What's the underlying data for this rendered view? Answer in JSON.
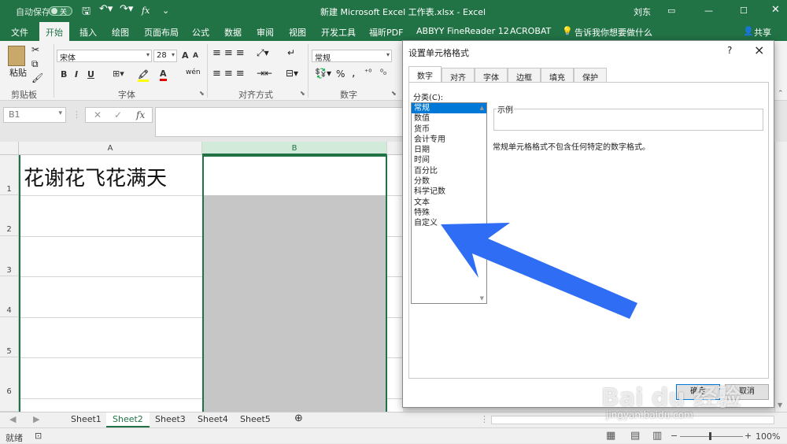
{
  "titlebar": {
    "autosave_label": "自动保存",
    "autosave_state": "关",
    "title": "新建 Microsoft Excel 工作表.xlsx - Excel",
    "user": "刘东"
  },
  "ribbon_tabs": [
    "文件",
    "开始",
    "插入",
    "绘图",
    "页面布局",
    "公式",
    "数据",
    "审阅",
    "视图",
    "开发工具",
    "福昕PDF",
    "ABBYY FineReader 12",
    "ACROBAT"
  ],
  "tell_me": "告诉我你想要做什么",
  "share": "共享",
  "ribbon": {
    "paste": "粘贴",
    "clipboard": "剪贴板",
    "font_name": "宋体",
    "font_size": "28",
    "font_group": "字体",
    "align_group": "对齐方式",
    "number_format": "常规",
    "number_group": "数字",
    "percent": "%",
    "comma": ",",
    "bold": "B",
    "italic": "I",
    "underline": "U",
    "font_color_letter": "A",
    "grow": "A",
    "wen": "wén"
  },
  "formula_bar": {
    "name_box": "B1",
    "fx": "fx",
    "value": ""
  },
  "grid": {
    "columns": [
      "A",
      "B"
    ],
    "rows": [
      "1",
      "2",
      "3",
      "4",
      "5",
      "6"
    ],
    "cell_A1": "花谢花飞花满天"
  },
  "sheets": [
    "Sheet1",
    "Sheet2",
    "Sheet3",
    "Sheet4",
    "Sheet5"
  ],
  "active_sheet": "Sheet2",
  "status": {
    "mode": "就绪",
    "zoom": "100%"
  },
  "dialog": {
    "title": "设置单元格格式",
    "help": "?",
    "close": "×",
    "tabs": [
      "数字",
      "对齐",
      "字体",
      "边框",
      "填充",
      "保护"
    ],
    "category_label": "分类(C):",
    "categories": [
      "常规",
      "数值",
      "货币",
      "会计专用",
      "日期",
      "时间",
      "百分比",
      "分数",
      "科学记数",
      "文本",
      "特殊",
      "自定义"
    ],
    "selected_category": "常规",
    "sample_label": "示例",
    "description": "常规单元格格式不包含任何特定的数字格式。",
    "ok": "确定",
    "cancel": "取消"
  },
  "watermark": {
    "text": "Bai du 经验",
    "url": "jingyan.baidu.com"
  },
  "colors": {
    "excel_green": "#217346",
    "selection_blue": "#0078d7",
    "arrow_blue": "#2f6df5"
  }
}
